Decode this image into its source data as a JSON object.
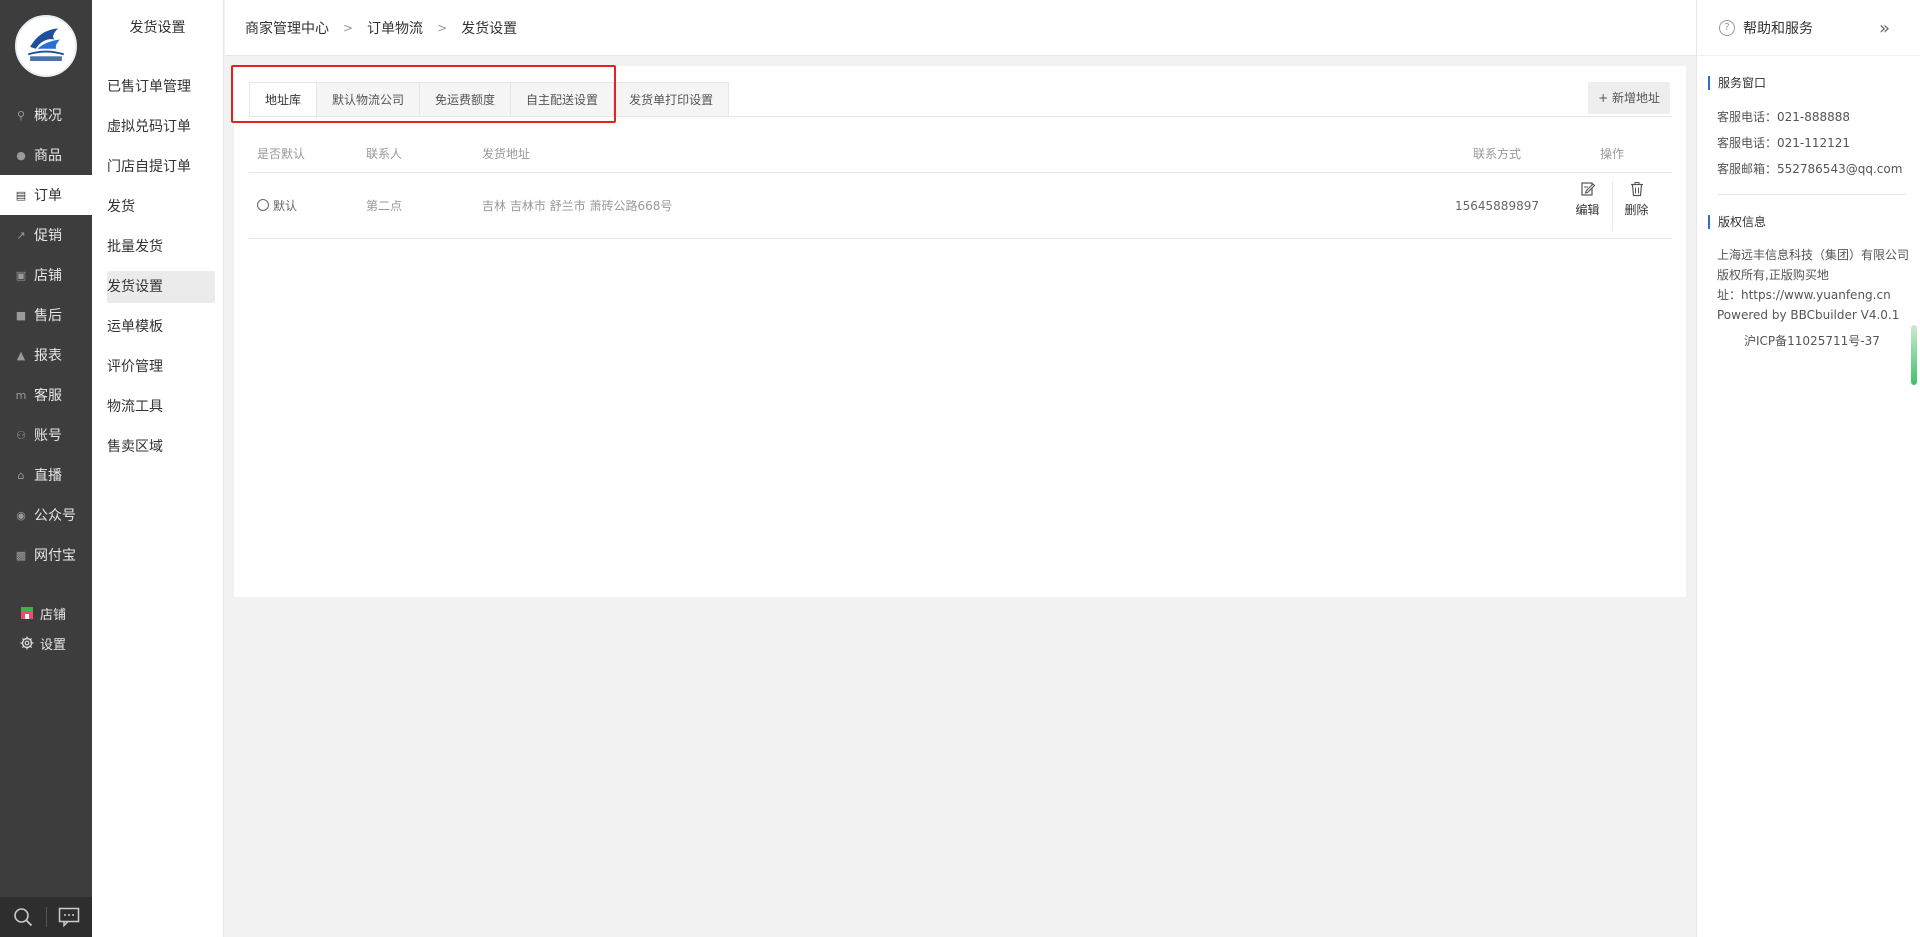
{
  "sidebar": {
    "items": [
      {
        "label": "概况",
        "icon": "search-icon"
      },
      {
        "label": "商品",
        "icon": "goods-icon"
      },
      {
        "label": "订单",
        "icon": "order-icon",
        "active": true
      },
      {
        "label": "促销",
        "icon": "promo-icon"
      },
      {
        "label": "店铺",
        "icon": "shop-icon"
      },
      {
        "label": "售后",
        "icon": "aftersale-icon"
      },
      {
        "label": "报表",
        "icon": "report-icon"
      },
      {
        "label": "客服",
        "icon": "service-icon"
      },
      {
        "label": "账号",
        "icon": "account-icon"
      },
      {
        "label": "直播",
        "icon": "live-icon"
      },
      {
        "label": "公众号",
        "icon": "wechat-icon"
      },
      {
        "label": "网付宝",
        "icon": "pay-icon"
      }
    ],
    "bottom": [
      {
        "label": "店铺",
        "icon": "store-icon"
      },
      {
        "label": "设置",
        "icon": "gear-icon"
      }
    ]
  },
  "submenu": {
    "title": "发货设置",
    "items": [
      "已售订单管理",
      "虚拟兑码订单",
      "门店自提订单",
      "发货",
      "批量发货",
      "发货设置",
      "运单模板",
      "评价管理",
      "物流工具",
      "售卖区域"
    ],
    "active_index": 5
  },
  "breadcrumb": [
    "商家管理中心",
    "订单物流",
    "发货设置"
  ],
  "tabs": [
    "地址库",
    "默认物流公司",
    "免运费额度",
    "自主配送设置",
    "发货单打印设置"
  ],
  "add_button": "+ 新增地址",
  "table": {
    "headers": [
      "是否默认",
      "联系人",
      "发货地址",
      "联系方式",
      "操作"
    ],
    "rows": [
      {
        "default": "默认",
        "contact": "第二点",
        "address": "吉林 吉林市 舒兰市 萧砖公路668号",
        "phone": "15645889897",
        "edit": "编辑",
        "delete": "删除"
      }
    ]
  },
  "help": {
    "title": "帮助和服务",
    "service_title": "服务窗口",
    "service_lines": [
      "客服电话：021-888888",
      "客服电话：021-112121",
      "客服邮箱：552786543@qq.com"
    ],
    "copyright_title": "版权信息",
    "copyright_lines": [
      "上海远丰信息科技（集团）有限公司",
      "版权所有,正版购买地",
      "址：https://www.yuanfeng.cn",
      "Powered by BBCbuilder V4.0.1",
      "沪ICP备11025711号-37"
    ]
  },
  "colors": {
    "sidebar_bg": "#3d3d3d",
    "accent_blue": "#2a6fd6",
    "highlight_red": "#e52222"
  }
}
